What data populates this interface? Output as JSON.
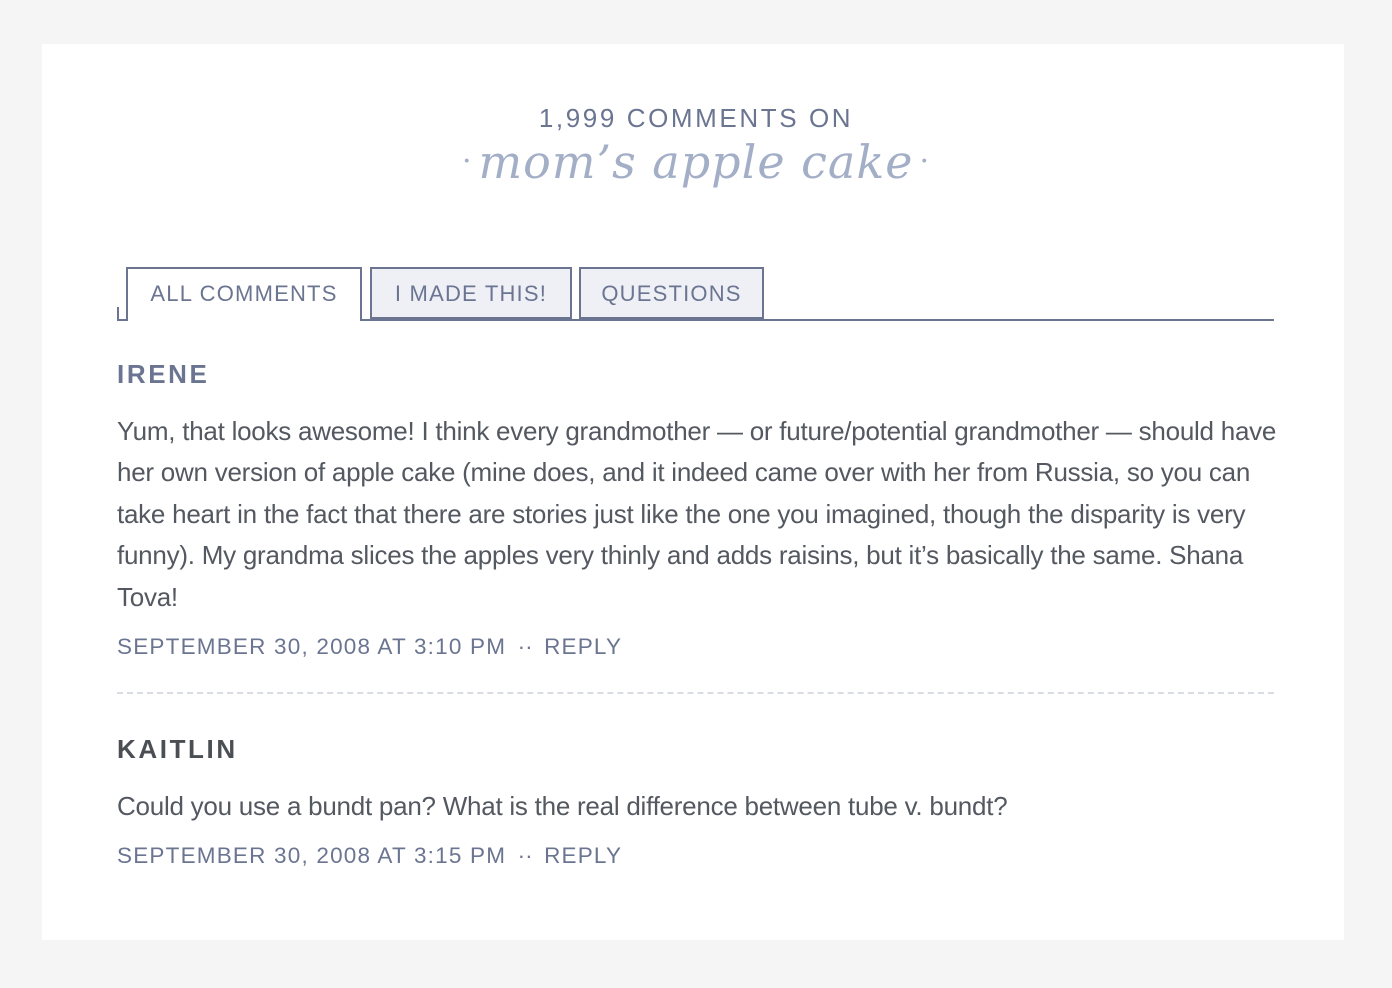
{
  "heading": {
    "count_text": "1,999 COMMENTS ON",
    "post_title": "mom’s apple cake",
    "dot": "·"
  },
  "tabs": [
    {
      "label": "ALL COMMENTS",
      "active": true
    },
    {
      "label": "I MADE THIS!",
      "active": false
    },
    {
      "label": "QUESTIONS",
      "active": false
    }
  ],
  "comments": [
    {
      "author": "IRENE",
      "body": "Yum, that looks awesome! I think every grandmother — or future/potential grandmother — should have her own version of apple cake (mine does, and it indeed came over with her from Russia, so you can take heart in the fact that there are stories just like the one you imagined, though the disparity is very funny). My grandma slices the apples very thinly and adds raisins, but it’s basically the same. Shana Tova!",
      "timestamp": "SEPTEMBER 30, 2008 AT 3:10 PM",
      "separator": "··",
      "reply_label": "REPLY"
    },
    {
      "author": "KAITLIN",
      "body": "Could you use a bundt pan? What is the real difference between tube v. bundt?",
      "timestamp": "SEPTEMBER 30, 2008 AT 3:15 PM",
      "separator": "··",
      "reply_label": "REPLY"
    }
  ],
  "colors": {
    "accent": "#6b7591",
    "title_script": "#a3aec7",
    "body_text": "#545860",
    "background": "#f4f5f4"
  }
}
